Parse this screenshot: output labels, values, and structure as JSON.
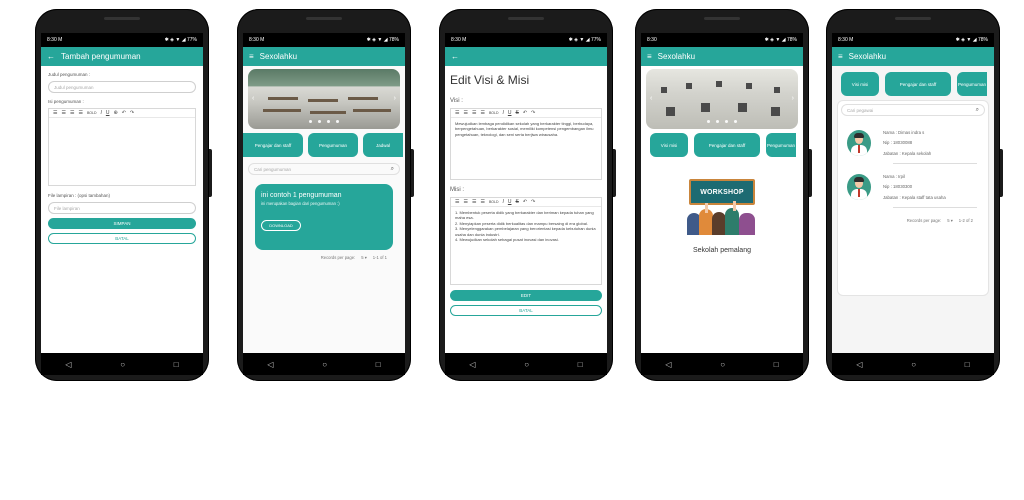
{
  "status": {
    "time": "8:30",
    "left_icons": "M",
    "right_text": "77%",
    "right_text_b": "78%",
    "left_icons_b": "M"
  },
  "phone1": {
    "title": "Tambah pengumuman",
    "judul_label": "Judul pengumuman :",
    "judul_placeholder": "Judul pengumuman",
    "isi_label": "Isi pengumuman :",
    "toolbar": [
      "B",
      "I",
      "U",
      "S",
      "BOLD",
      "I",
      "U",
      "S",
      "↶",
      "↷"
    ],
    "file_label": "File lampiran : (opsi tambahan)",
    "file_placeholder": "File lampiran",
    "simpan": "SIMPAN",
    "batal": "BATAL"
  },
  "phone2": {
    "title": "Sexolahku",
    "chips": [
      "Pengajar dan staff",
      "Pengumuman",
      "Jadwal"
    ],
    "search_placeholder": "Cari pengumuman",
    "card_title": "ini contoh 1 pengumuman",
    "card_sub": "ini merupakan bagian dari pengumuman :)",
    "download": "DOWNLOAD",
    "records_label": "Records per page:",
    "records_value": "5",
    "range": "1-1 of 1"
  },
  "phone3": {
    "heading": "Edit Visi & Misi",
    "visi_label": "Visi :",
    "visi_text": "Mewujudkan lembaga pendidikan sekolah yang berkarakter tinggi, berbudaya, berpengetahuan, berkarakter sosial, memiliki kompetensi pengembangan ilmu pengetahuan, teknologi, dan seni serta berjiwa wirausaha.",
    "misi_label": "Misi :",
    "misi_lines": [
      "1. Membentuk peserta didik yang berkarakter dan beriman kepada tuhan yang maha esa.",
      "2. Menyiapkan peserta didik berkualitas dan mampu bersaing di era global.",
      "3. Menyelenggarakan pembelajaran yang berorientasi kepada kebutuhan dunia usaha dan dunia industri.",
      "4. Mewujudkan sekolah sebagai pusat inovasi dan inovasi."
    ],
    "edit": "EDIT",
    "batal": "BATAL"
  },
  "phone4": {
    "title": "Sexolahku",
    "chips": [
      "Visi misi",
      "Pengajar dan staff",
      "Pengumuman"
    ],
    "workshop_label": "WORKSHOP",
    "caption": "Sekolah pemalang"
  },
  "phone5": {
    "title": "Sexolahku",
    "chips": [
      "Visi misi",
      "Pengajar dan staff",
      "Pengumuman"
    ],
    "search_placeholder": "Cari pegawai",
    "staff": [
      {
        "name": "Nama : Dimas indra s",
        "nip": "Nip : 18030088",
        "jabatan": "Jabatan : Kepala sekolah"
      },
      {
        "name": "Nama : Irpil",
        "nip": "Nip : 18030300",
        "jabatan": "Jabatan : Kepala staff tata usaha"
      }
    ],
    "records_label": "Records per page:",
    "records_value": "5",
    "range": "1-2 of 2"
  },
  "nav": {
    "back": "◁",
    "home": "○",
    "recent": "□"
  },
  "colors": {
    "accent": "#26a69a"
  }
}
